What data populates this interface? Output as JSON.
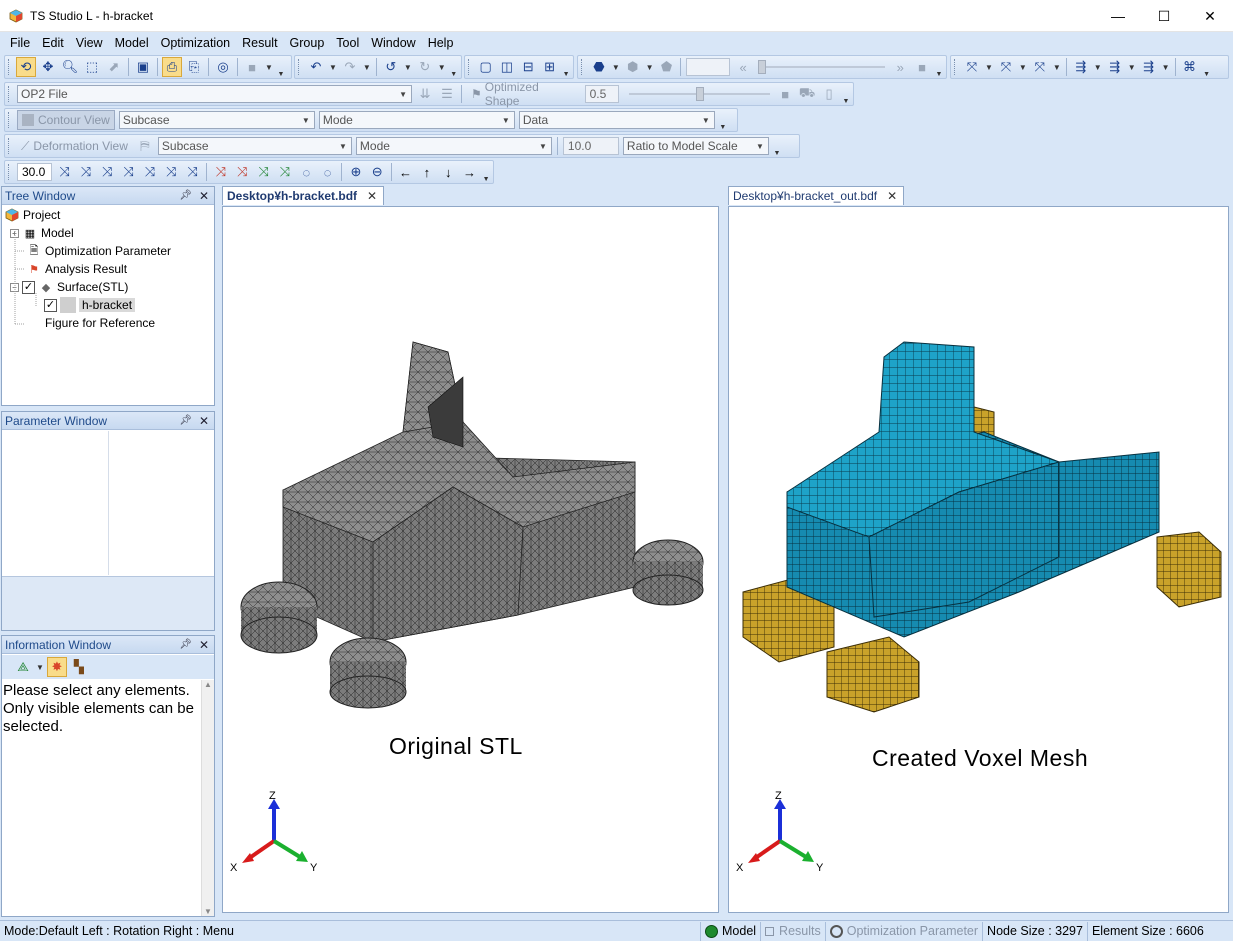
{
  "window": {
    "title": "TS Studio L - h-bracket",
    "minimize_glyph": "—",
    "maximize_glyph": "☐",
    "close_glyph": "✕"
  },
  "menu": [
    "File",
    "Edit",
    "View",
    "Model",
    "Optimization",
    "Result",
    "Group",
    "Tool",
    "Window",
    "Help"
  ],
  "toolbar2": {
    "op2_combo": "OP2 File",
    "optimized_shape_label": "Optimized Shape",
    "optimized_shape_value": "0.5",
    "slider_level": 0.5
  },
  "toolbar3": {
    "contour_view_label": "Contour View",
    "subcase": "Subcase",
    "mode": "Mode",
    "data": "Data"
  },
  "toolbar4": {
    "deformation_view_label": "Deformation View",
    "subcase": "Subcase",
    "mode": "Mode",
    "scale_value": "10.0",
    "ratio_combo": "Ratio to Model Scale"
  },
  "toolbar5": {
    "angle_value": "30.0"
  },
  "tree_window": {
    "title": "Tree Window",
    "items": [
      {
        "label": "Project"
      },
      {
        "label": "Model"
      },
      {
        "label": "Optimization Parameter"
      },
      {
        "label": "Analysis Result"
      },
      {
        "label": "Surface(STL)"
      },
      {
        "label": "h-bracket"
      },
      {
        "label": "Figure for Reference"
      }
    ]
  },
  "parameter_window": {
    "title": "Parameter Window"
  },
  "information_window": {
    "title": "Information Window",
    "message": "Please select any elements. Only visible elements can be selected."
  },
  "tabs": {
    "left": "Desktop¥h-bracket.bdf",
    "right": "Desktop¥h-bracket_out.bdf"
  },
  "viewports": {
    "left_label": "Original STL",
    "right_label": "Created Voxel Mesh",
    "axis_x": "X",
    "axis_y": "Y",
    "axis_z": "Z"
  },
  "status": {
    "mode": "Mode:Default  Left : Rotation Right : Menu",
    "model": "Model",
    "results": "Results",
    "optimization_parameter": "Optimization Parameter",
    "node_size": "Node Size : 3297",
    "element_size": "Element Size : 6606"
  },
  "colors": {
    "stl_gray": "#8e8e8e",
    "voxel_blue": "#1ea3c8",
    "voxel_gold": "#c9a22a",
    "panel_title": "#1f4a8a"
  }
}
